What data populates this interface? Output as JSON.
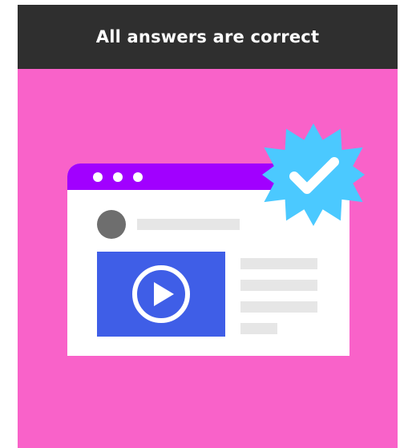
{
  "header": {
    "title": "All answers are correct"
  },
  "illustration": {
    "browser_bar_color": "#a100ff",
    "video_panel_color": "#3f5ee7",
    "badge_color": "#4bc9ff",
    "icons": [
      "play-icon",
      "checkmark-icon"
    ]
  },
  "colors": {
    "background": "#f962c9",
    "header_bg": "#2f2f2f"
  }
}
